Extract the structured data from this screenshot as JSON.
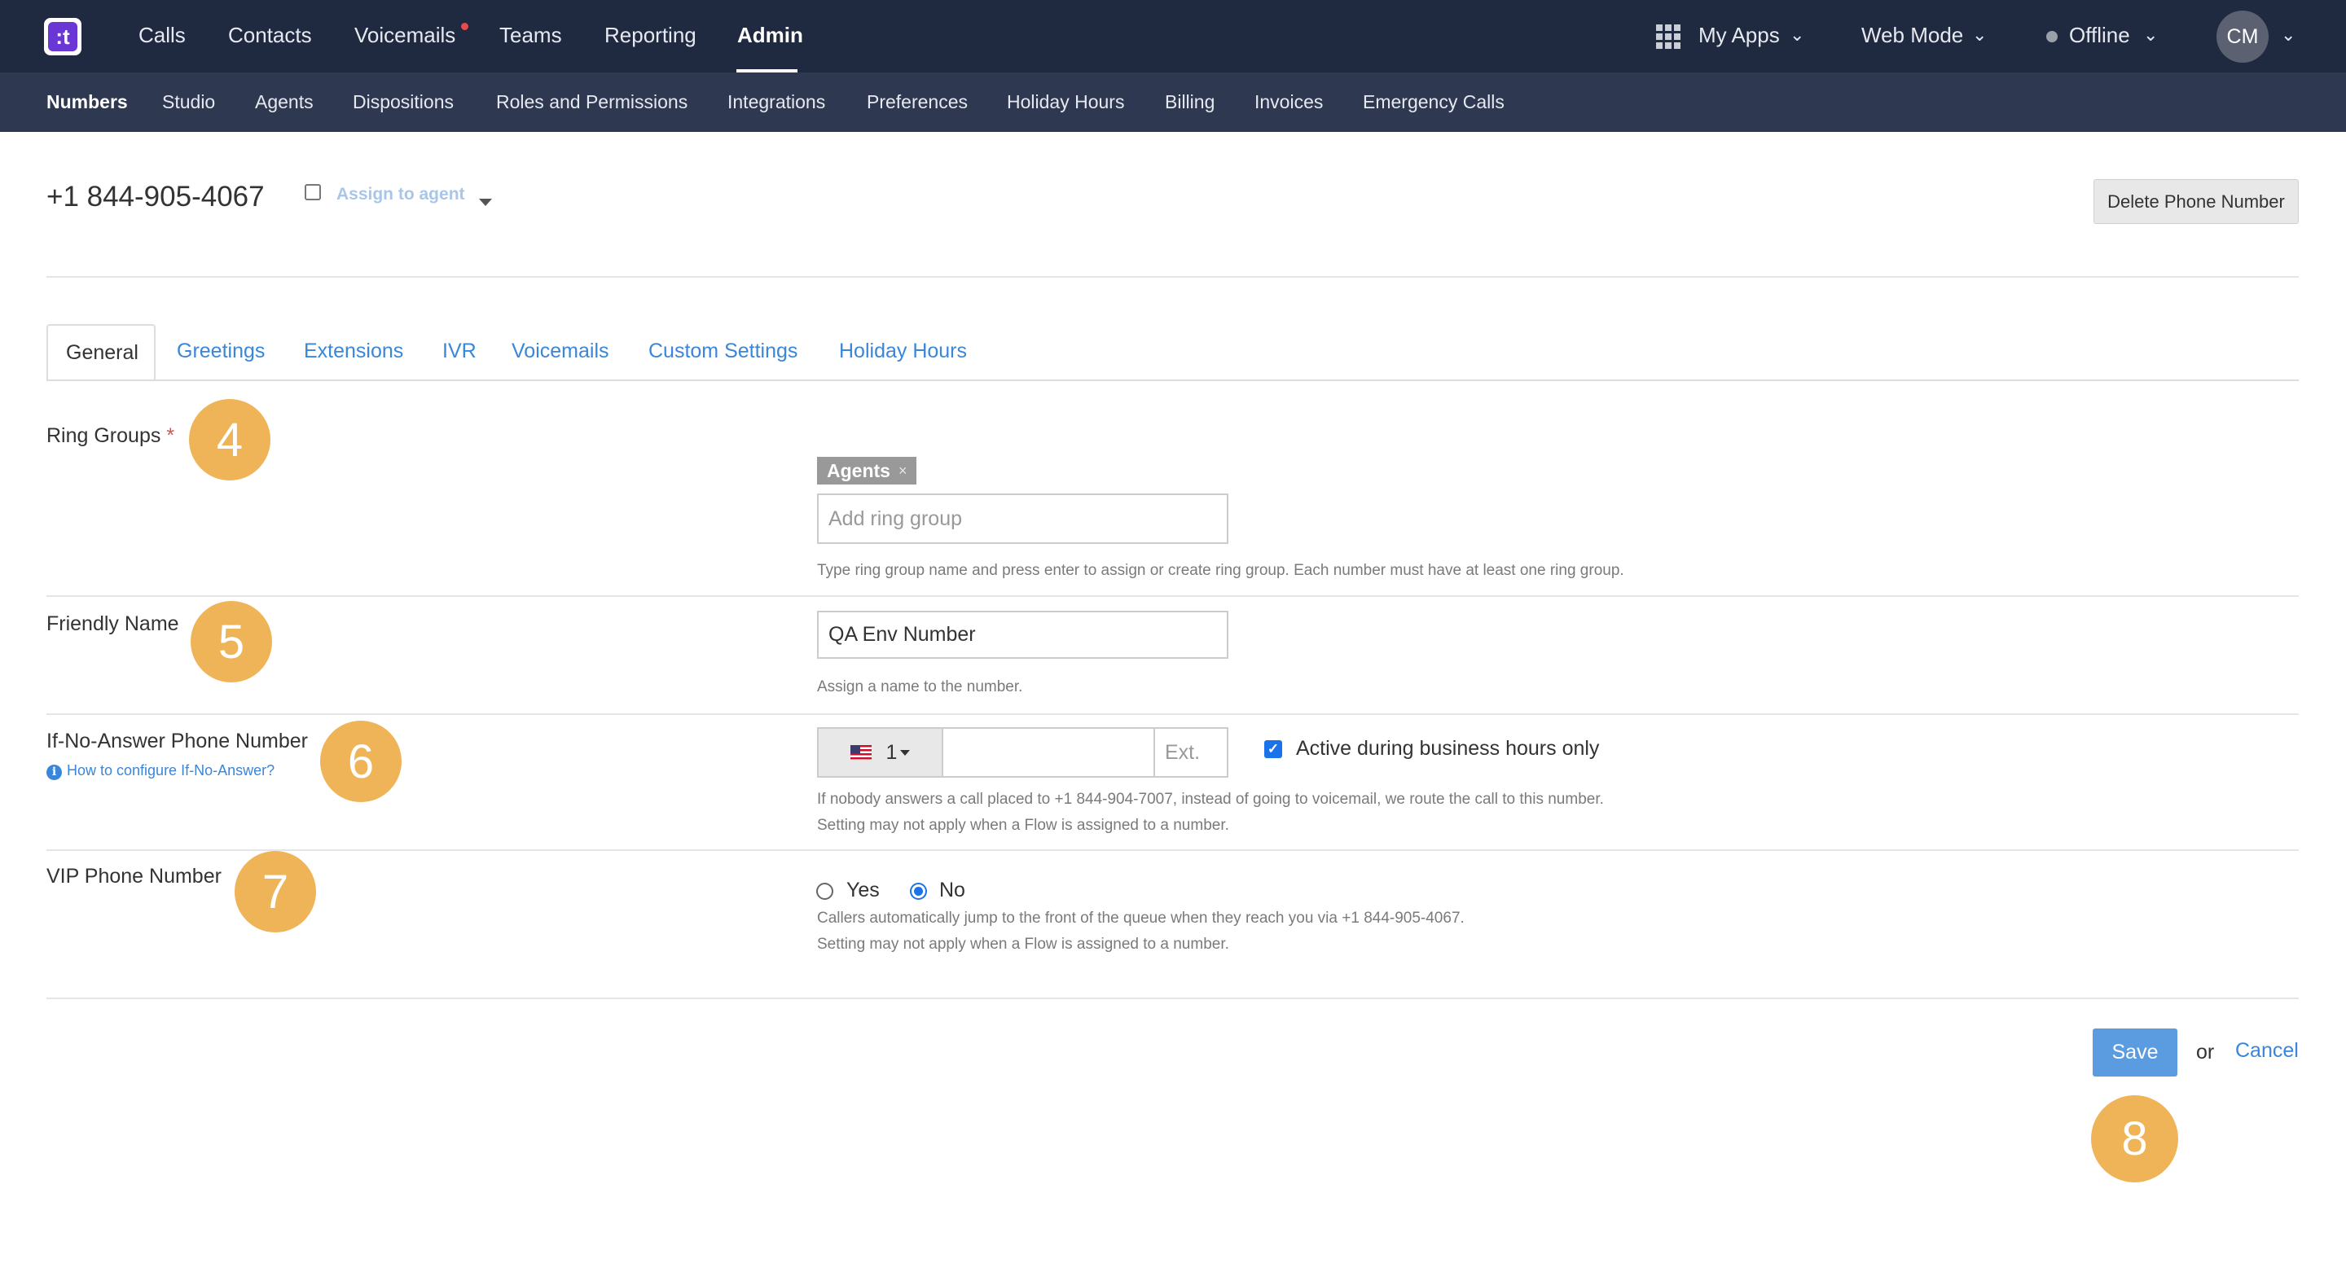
{
  "topnav": {
    "logo_text": ":t",
    "items": [
      "Calls",
      "Contacts",
      "Voicemails",
      "Teams",
      "Reporting",
      "Admin"
    ],
    "active": "Admin",
    "my_apps": "My Apps",
    "web_mode": "Web Mode",
    "status": "Offline",
    "avatar_initials": "CM"
  },
  "subnav": {
    "items": [
      "Numbers",
      "Studio",
      "Agents",
      "Dispositions",
      "Roles and Permissions",
      "Integrations",
      "Preferences",
      "Holiday Hours",
      "Billing",
      "Invoices",
      "Emergency Calls"
    ],
    "active": "Numbers"
  },
  "header": {
    "phone_number": "+1 844-905-4067",
    "assign_label": "Assign to agent",
    "assign_checked": false,
    "delete_button": "Delete Phone Number"
  },
  "tabs": {
    "items": [
      "General",
      "Greetings",
      "Extensions",
      "IVR",
      "Voicemails",
      "Custom Settings",
      "Holiday Hours"
    ],
    "active": "General"
  },
  "form": {
    "ring_groups": {
      "label": "Ring Groups",
      "required_mark": "*",
      "tag": "Agents",
      "tag_remove": "×",
      "placeholder": "Add ring group",
      "help": "Type ring group name and press enter to assign or create ring group. Each number must have at least one ring group."
    },
    "friendly_name": {
      "label": "Friendly Name",
      "value": "QA Env Number",
      "help": "Assign a name to the number."
    },
    "if_no_answer": {
      "label": "If-No-Answer Phone Number",
      "link": "How to configure If-No-Answer?",
      "country_code": "1",
      "ext_placeholder": "Ext.",
      "business_hours_label": "Active during business hours only",
      "business_hours_checked": true,
      "help_line1": "If nobody answers a call placed to +1 844-904-7007, instead of going to voicemail, we route the call to this number.",
      "help_line2": "Setting may not apply when a Flow is assigned to a number."
    },
    "vip": {
      "label": "VIP Phone Number",
      "options": [
        "Yes",
        "No"
      ],
      "selected": "No",
      "help_line1": "Callers automatically jump to the front of the queue when they reach you via +1 844-905-4067.",
      "help_line2": "Setting may not apply when a Flow is assigned to a number."
    }
  },
  "actions": {
    "save": "Save",
    "or": "or",
    "cancel": "Cancel"
  },
  "step_badges": [
    "4",
    "5",
    "6",
    "7",
    "8"
  ],
  "colors": {
    "topbar": "#1f2940",
    "subbar": "#2e3850",
    "accent": "#3a86d9",
    "badge": "#f0b458",
    "save_button": "#5b9bdf"
  }
}
